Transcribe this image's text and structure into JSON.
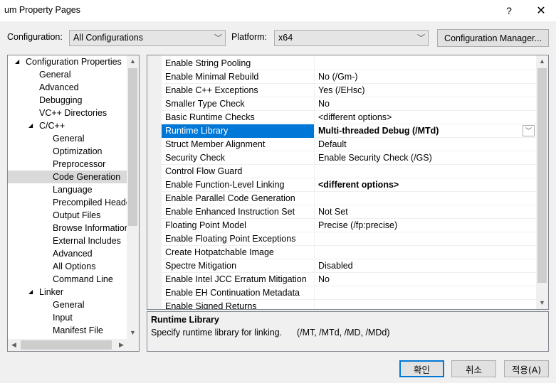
{
  "window": {
    "title": "um Property Pages",
    "help_glyph": "?",
    "close_glyph": "✕"
  },
  "config": {
    "configuration_label": "Configuration:",
    "configuration_value": "All Configurations",
    "platform_label": "Platform:",
    "platform_value": "x64",
    "manager_button": "Configuration Manager..."
  },
  "tree": {
    "items": [
      {
        "label": "Configuration Properties",
        "level": 0,
        "expander": "◢"
      },
      {
        "label": "General",
        "level": 1
      },
      {
        "label": "Advanced",
        "level": 1
      },
      {
        "label": "Debugging",
        "level": 1
      },
      {
        "label": "VC++ Directories",
        "level": 1
      },
      {
        "label": "C/C++",
        "level": 1,
        "expander": "◢"
      },
      {
        "label": "General",
        "level": 2
      },
      {
        "label": "Optimization",
        "level": 2
      },
      {
        "label": "Preprocessor",
        "level": 2
      },
      {
        "label": "Code Generation",
        "level": 2,
        "selected": true
      },
      {
        "label": "Language",
        "level": 2
      },
      {
        "label": "Precompiled Heade",
        "level": 2
      },
      {
        "label": "Output Files",
        "level": 2
      },
      {
        "label": "Browse Informatior",
        "level": 2
      },
      {
        "label": "External Includes",
        "level": 2
      },
      {
        "label": "Advanced",
        "level": 2
      },
      {
        "label": "All Options",
        "level": 2
      },
      {
        "label": "Command Line",
        "level": 2
      },
      {
        "label": "Linker",
        "level": 1,
        "expander": "◢"
      },
      {
        "label": "General",
        "level": 2
      },
      {
        "label": "Input",
        "level": 2
      },
      {
        "label": "Manifest File",
        "level": 2
      }
    ]
  },
  "properties": [
    {
      "name": "Enable String Pooling",
      "value": ""
    },
    {
      "name": "Enable Minimal Rebuild",
      "value": "No (/Gm-)"
    },
    {
      "name": "Enable C++ Exceptions",
      "value": "Yes (/EHsc)"
    },
    {
      "name": "Smaller Type Check",
      "value": "No"
    },
    {
      "name": "Basic Runtime Checks",
      "value": "<different options>"
    },
    {
      "name": "Runtime Library",
      "value": "Multi-threaded Debug (/MTd)",
      "bold": true,
      "selected": true
    },
    {
      "name": "Struct Member Alignment",
      "value": "Default"
    },
    {
      "name": "Security Check",
      "value": "Enable Security Check (/GS)"
    },
    {
      "name": "Control Flow Guard",
      "value": ""
    },
    {
      "name": "Enable Function-Level Linking",
      "value": "<different options>",
      "bold": true
    },
    {
      "name": "Enable Parallel Code Generation",
      "value": ""
    },
    {
      "name": "Enable Enhanced Instruction Set",
      "value": "Not Set"
    },
    {
      "name": "Floating Point Model",
      "value": "Precise (/fp:precise)"
    },
    {
      "name": "Enable Floating Point Exceptions",
      "value": ""
    },
    {
      "name": "Create Hotpatchable Image",
      "value": ""
    },
    {
      "name": "Spectre Mitigation",
      "value": "Disabled"
    },
    {
      "name": "Enable Intel JCC Erratum Mitigation",
      "value": "No"
    },
    {
      "name": "Enable EH Continuation Metadata",
      "value": ""
    },
    {
      "name": "Enable Signed Returns",
      "value": ""
    }
  ],
  "description": {
    "title": "Runtime Library",
    "text": "Specify runtime library for linking.      (/MT, /MTd, /MD, /MDd)"
  },
  "buttons": {
    "ok": "확인",
    "cancel": "취소",
    "apply": "적용(A)"
  },
  "colors": {
    "selection": "#0078d7",
    "tree_selection": "#d9d9d9"
  }
}
